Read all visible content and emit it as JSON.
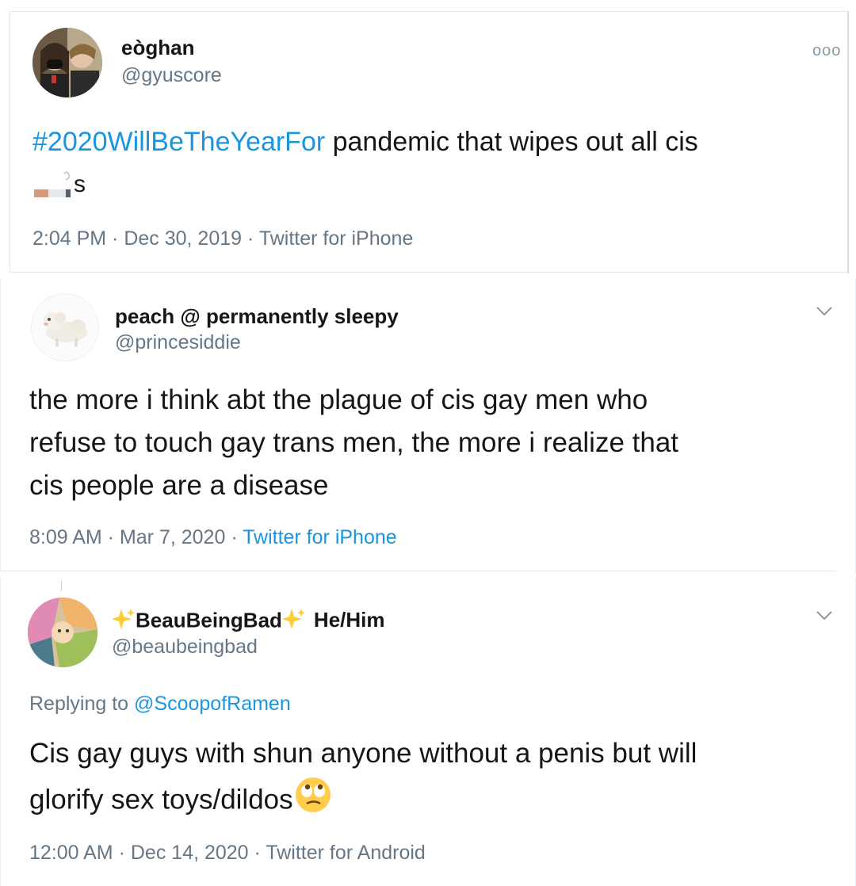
{
  "tweets": [
    {
      "name": "eòghan",
      "handle": "@gyuscore",
      "hashtag": "#2020WillBeTheYearFor",
      "text": " pandemic that wipes out all cis",
      "text2": "s",
      "emoji_icon": "cigarette-icon",
      "time": "2:04 PM",
      "date": "Dec 30, 2019",
      "source": "Twitter for iPhone",
      "more_label": "ooo"
    },
    {
      "name": "peach @ permanently sleepy",
      "handle": "@princesiddie",
      "lines": [
        "the more i think abt the plague of cis gay men who",
        "refuse to touch gay trans men, the more i realize that",
        "cis people are a disease"
      ],
      "time": "8:09 AM",
      "date": "Mar 7, 2020",
      "source": "Twitter for iPhone"
    },
    {
      "name": "BeauBeingBad",
      "pronouns": "He/Him",
      "handle": "@beaubeingbad",
      "replying_prefix": "Replying to ",
      "replying_to": "@ScoopofRamen",
      "lines": [
        "Cis gay guys with shun anyone without a penis but will",
        "glorify sex toys/dildos"
      ],
      "emoji_icon": "face-with-rolling-eyes-icon",
      "time": "12:00 AM",
      "date": "Dec 14, 2020",
      "source": "Twitter for Android"
    }
  ],
  "colors": {
    "link": "#1b95e0",
    "secondary_text": "#657786",
    "primary_text": "#14171a",
    "border": "#e1e8ed"
  }
}
